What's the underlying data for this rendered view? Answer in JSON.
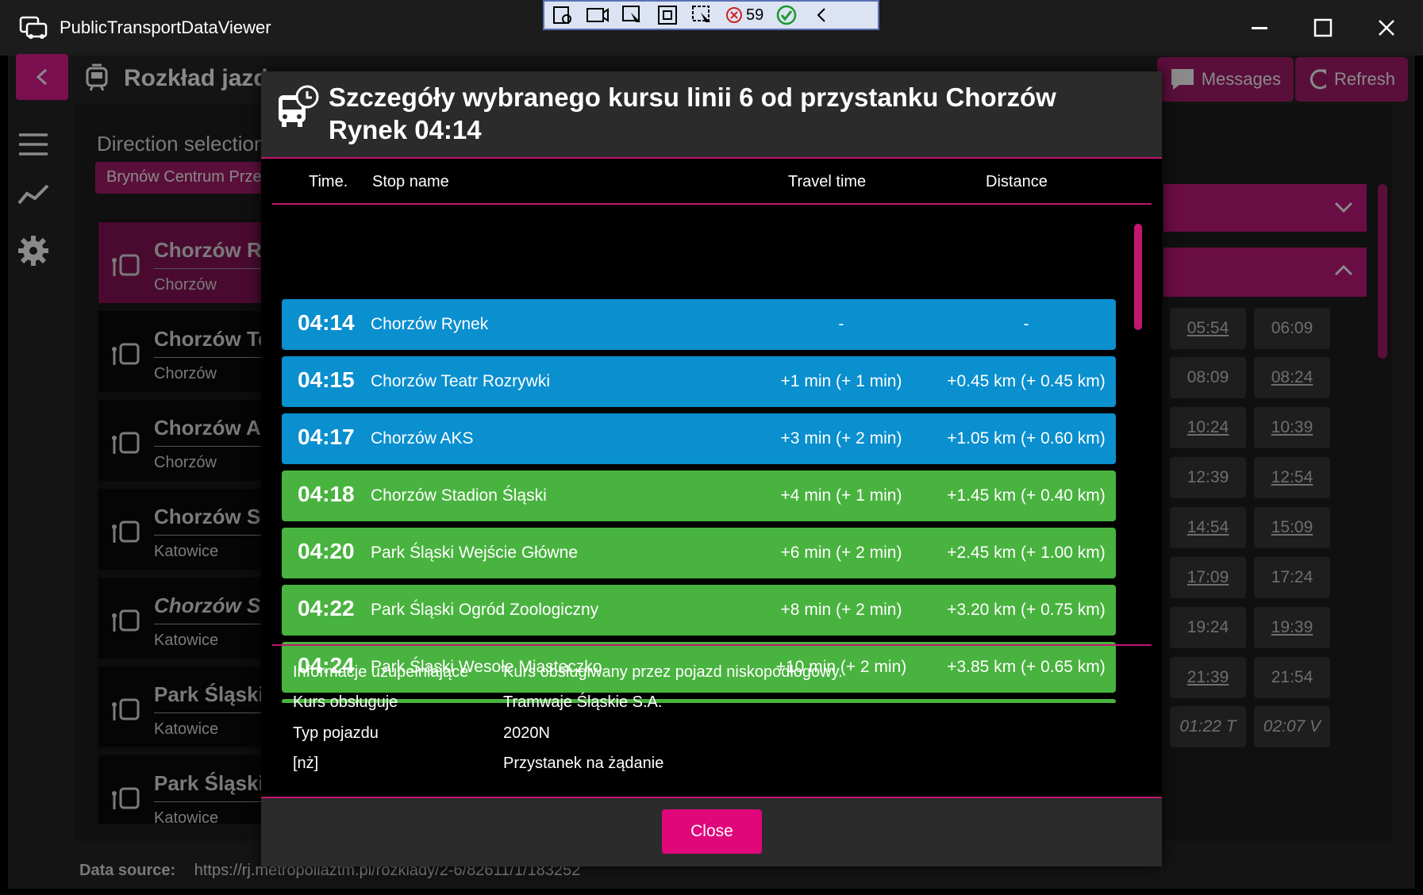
{
  "window": {
    "title": "PublicTransportDataViewer",
    "debug_count": "59"
  },
  "app": {
    "page_title": "Rozkład jazdy",
    "messages_label": "Messages",
    "refresh_label": "Refresh",
    "direction_label": "Direction selection",
    "direction_value": "Brynów Centrum Prze",
    "stops": [
      {
        "name": "Chorzów Ry",
        "city": "Chorzów",
        "active": true
      },
      {
        "name": "Chorzów Tea",
        "city": "Chorzów"
      },
      {
        "name": "Chorzów AK",
        "city": "Chorzów"
      },
      {
        "name": "Chorzów Sta",
        "city": "Katowice"
      },
      {
        "name": "Chorzów Sta",
        "city": "Katowice"
      },
      {
        "name": "Park Śląski W",
        "city": "Katowice"
      },
      {
        "name": "Park Śląski O",
        "city": "Katowice"
      }
    ],
    "times": [
      [
        "05:54",
        "06:09"
      ],
      [
        "08:09",
        "08:24"
      ],
      [
        "10:24",
        "10:39"
      ],
      [
        "12:39",
        "12:54"
      ],
      [
        "14:54",
        "15:09"
      ],
      [
        "17:09",
        "17:24"
      ],
      [
        "19:24",
        "19:39"
      ],
      [
        "21:39",
        "21:54"
      ],
      [
        "01:22 T",
        "02:07 V"
      ]
    ],
    "data_source_label": "Data source:",
    "data_source_url": "https://rj.metropoliaztm.pl/rozklady/2-6/82611/1/183252"
  },
  "dialog": {
    "title": "Szczegóły wybranego kursu linii 6 od przystanku Chorzów Rynek 04:14",
    "columns": {
      "time": "Time.",
      "stop": "Stop name",
      "travel": "Travel time",
      "distance": "Distance"
    },
    "rows": [
      {
        "time": "04:14",
        "stop": "Chorzów Rynek",
        "travel": "-",
        "distance": "-",
        "color": "#0a8fcf"
      },
      {
        "time": "04:15",
        "stop": "Chorzów Teatr Rozrywki",
        "travel": "+1 min (+ 1 min)",
        "distance": "+0.45 km (+ 0.45 km)",
        "color": "#0a8fcf"
      },
      {
        "time": "04:17",
        "stop": "Chorzów AKS",
        "travel": "+3 min (+ 2 min)",
        "distance": "+1.05 km (+ 0.60 km)",
        "color": "#0a8fcf"
      },
      {
        "time": "04:18",
        "stop": "Chorzów Stadion Śląski",
        "travel": "+4 min (+ 1 min)",
        "distance": "+1.45 km (+ 0.40 km)",
        "color": "#49b33f"
      },
      {
        "time": "04:20",
        "stop": "Park Śląski Wejście Główne",
        "travel": "+6 min (+ 2 min)",
        "distance": "+2.45 km (+ 1.00 km)",
        "color": "#49b33f"
      },
      {
        "time": "04:22",
        "stop": "Park Śląski Ogród Zoologiczny",
        "travel": "+8 min (+ 2 min)",
        "distance": "+3.20 km (+ 0.75 km)",
        "color": "#49b33f"
      },
      {
        "time": "04:24",
        "stop": "Park Śląski Wesołe Miasteczko",
        "travel": "+10 min (+ 2 min)",
        "distance": "+3.85 km (+ 0.65 km)",
        "color": "#49b33f"
      }
    ],
    "info": [
      {
        "key": "Informacje uzupełniające",
        "value": "Kurs obsługiwany przez pojazd niskopodłogowy."
      },
      {
        "key": "Kurs obsługuje",
        "value": "Tramwaje Śląskie S.A."
      },
      {
        "key": "Typ pojazdu",
        "value": "2020N"
      },
      {
        "key": "[nż]",
        "value": "Przystanek na żądanie"
      }
    ],
    "close_label": "Close"
  },
  "colors": {
    "accent": "#c2176e",
    "button": "#e0077a",
    "blue_row": "#0a8fcf",
    "green_row": "#49b33f"
  }
}
